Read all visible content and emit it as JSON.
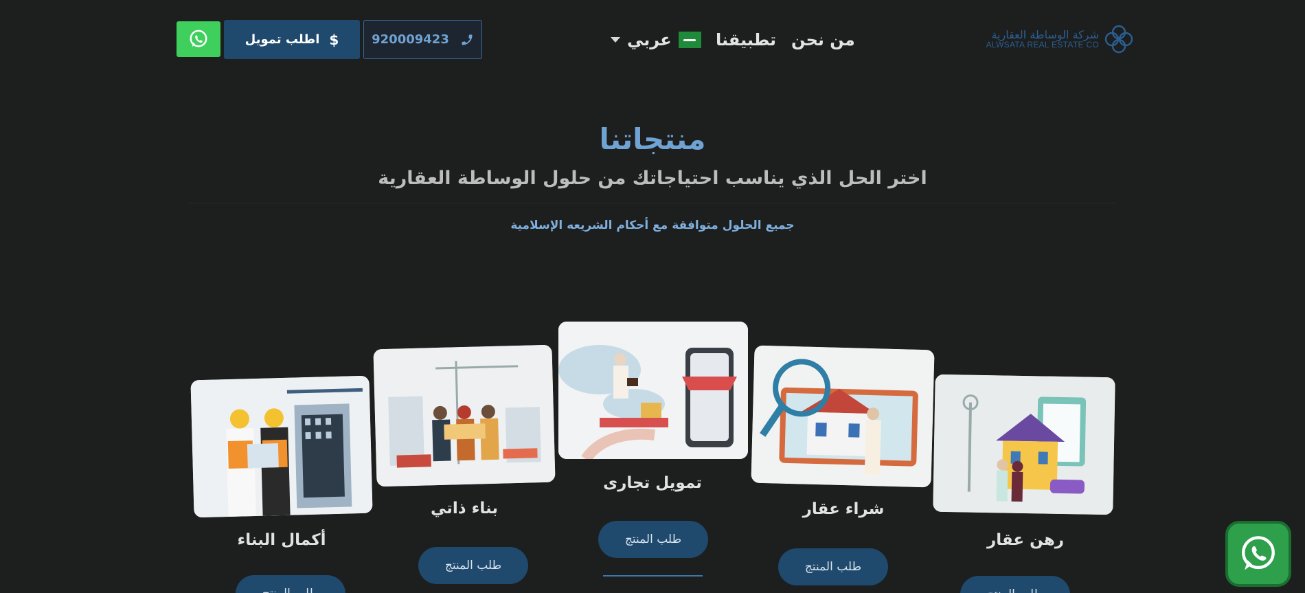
{
  "header": {
    "whatsapp_icon": "whatsapp-icon",
    "finance_button": {
      "label": "اطلب تمويل",
      "icon": "$"
    },
    "phone_button": {
      "number": "920009423",
      "icon": "phone-icon"
    },
    "nav": {
      "about": "من نحن",
      "apps": "تطبيقنا",
      "language": "عربي"
    },
    "logo": {
      "arabic": "شركة الوساطة العقارية",
      "english": "ALWSATA REAL ESTATE CO"
    }
  },
  "products": {
    "title": "منتجاتنا",
    "subtitle": "اختر الحل الذي يناسب احتياجاتك من حلول الوساطة العقارية",
    "note": "جميع الحلول متوافقة مع أحكام الشريعه الإسلامية",
    "button_label": "طلب المنتج",
    "cards": [
      {
        "title": "أكمال البناء"
      },
      {
        "title": "بناء ذاتي"
      },
      {
        "title": "تمويل تجارى"
      },
      {
        "title": "شراء عقار"
      },
      {
        "title": "رهن عقار"
      }
    ]
  },
  "colors": {
    "background": "#1d1e1e",
    "accent_blue": "#6fa3d4",
    "button_blue": "#1f4a6e",
    "whatsapp_green": "#3fcf5c"
  }
}
